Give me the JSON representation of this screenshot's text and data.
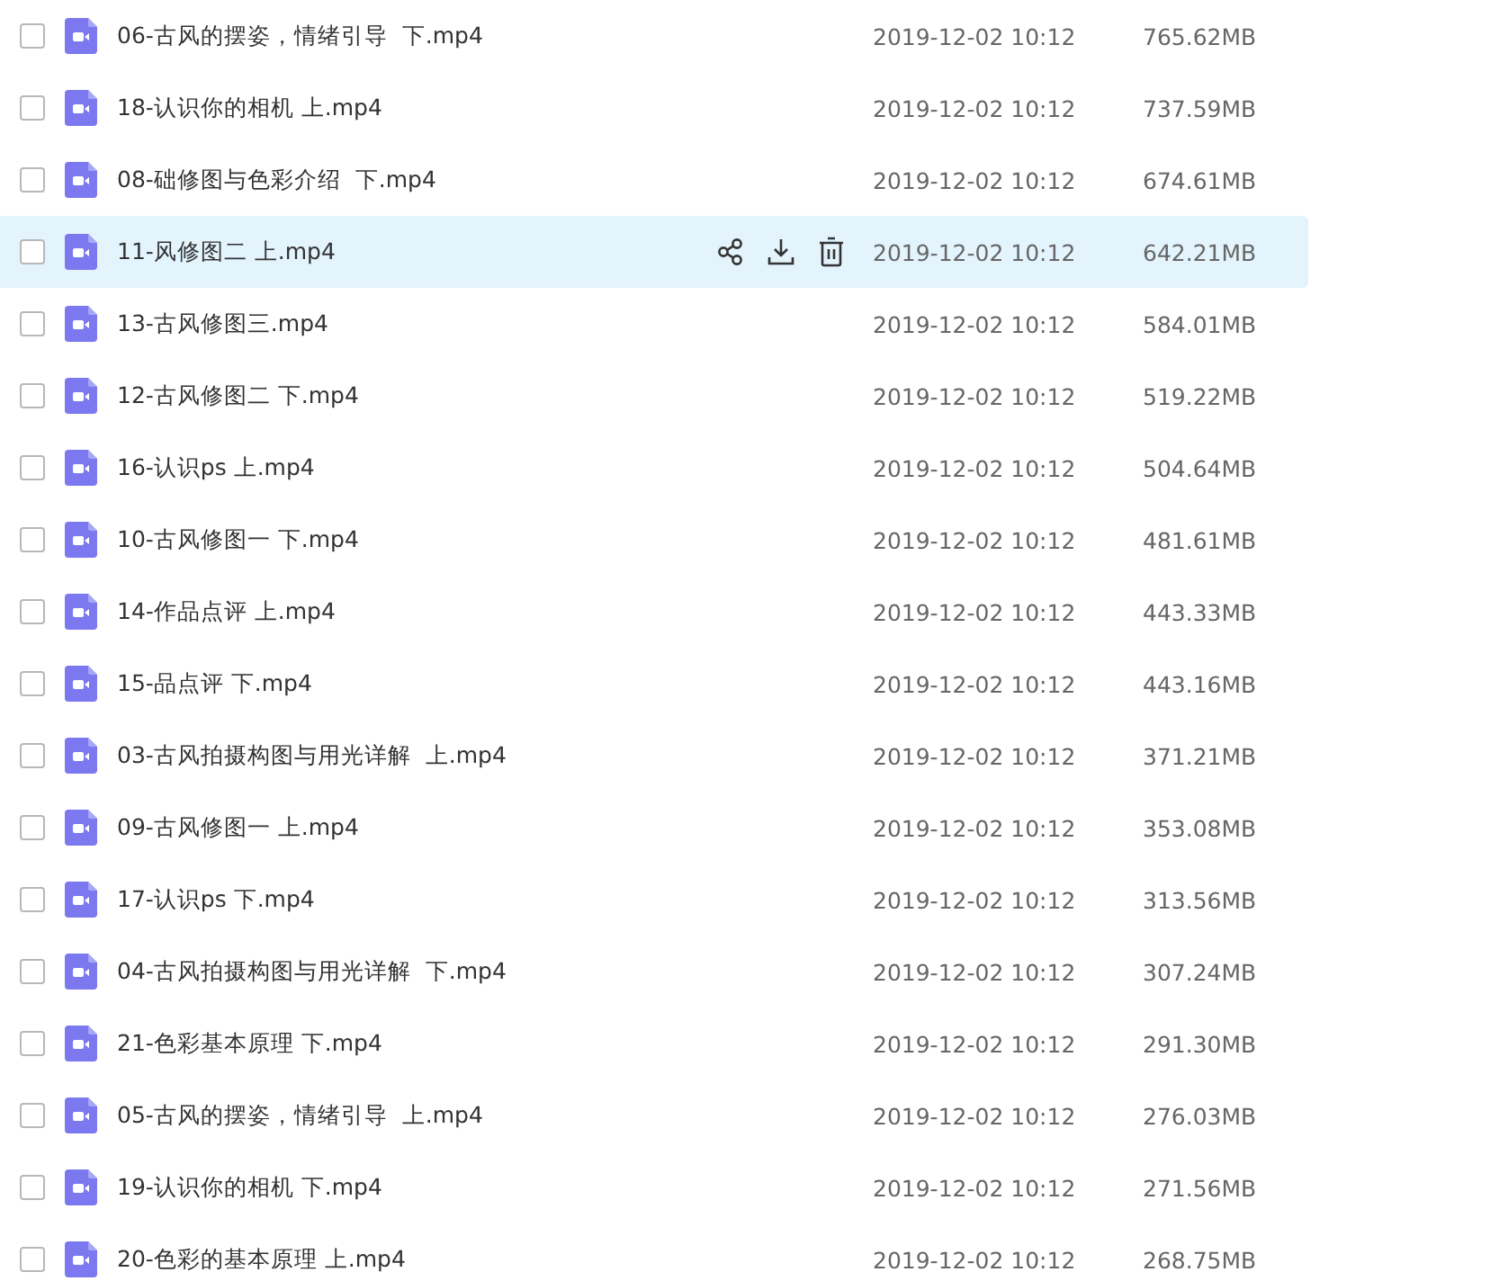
{
  "files": [
    {
      "name": "06-古风的摆姿，情绪引导  下.mp4",
      "date": "2019-12-02 10:12",
      "size": "765.62MB",
      "checked": false,
      "highlighted": false
    },
    {
      "name": "18-认识你的相机 上.mp4",
      "date": "2019-12-02 10:12",
      "size": "737.59MB",
      "checked": false,
      "highlighted": false
    },
    {
      "name": "08-础修图与色彩介绍  下.mp4",
      "date": "2019-12-02 10:12",
      "size": "674.61MB",
      "checked": false,
      "highlighted": false
    },
    {
      "name": "11-风修图二 上.mp4",
      "date": "2019-12-02 10:12",
      "size": "642.21MB",
      "checked": false,
      "highlighted": true
    },
    {
      "name": "13-古风修图三.mp4",
      "date": "2019-12-02 10:12",
      "size": "584.01MB",
      "checked": false,
      "highlighted": false
    },
    {
      "name": "12-古风修图二 下.mp4",
      "date": "2019-12-02 10:12",
      "size": "519.22MB",
      "checked": false,
      "highlighted": false
    },
    {
      "name": "16-认识ps 上.mp4",
      "date": "2019-12-02 10:12",
      "size": "504.64MB",
      "checked": false,
      "highlighted": false
    },
    {
      "name": "10-古风修图一 下.mp4",
      "date": "2019-12-02 10:12",
      "size": "481.61MB",
      "checked": false,
      "highlighted": false
    },
    {
      "name": "14-作品点评 上.mp4",
      "date": "2019-12-02 10:12",
      "size": "443.33MB",
      "checked": false,
      "highlighted": false
    },
    {
      "name": "15-品点评 下.mp4",
      "date": "2019-12-02 10:12",
      "size": "443.16MB",
      "checked": false,
      "highlighted": false
    },
    {
      "name": "03-古风拍摄构图与用光详解  上.mp4",
      "date": "2019-12-02 10:12",
      "size": "371.21MB",
      "checked": false,
      "highlighted": false
    },
    {
      "name": "09-古风修图一 上.mp4",
      "date": "2019-12-02 10:12",
      "size": "353.08MB",
      "checked": false,
      "highlighted": false
    },
    {
      "name": "17-认识ps 下.mp4",
      "date": "2019-12-02 10:12",
      "size": "313.56MB",
      "checked": false,
      "highlighted": false
    },
    {
      "name": "04-古风拍摄构图与用光详解  下.mp4",
      "date": "2019-12-02 10:12",
      "size": "307.24MB",
      "checked": false,
      "highlighted": false
    },
    {
      "name": "21-色彩基本原理 下.mp4",
      "date": "2019-12-02 10:12",
      "size": "291.30MB",
      "checked": false,
      "highlighted": false
    },
    {
      "name": "05-古风的摆姿，情绪引导  上.mp4",
      "date": "2019-12-02 10:12",
      "size": "276.03MB",
      "checked": false,
      "highlighted": false
    },
    {
      "name": "19-认识你的相机 下.mp4",
      "date": "2019-12-02 10:12",
      "size": "271.56MB",
      "checked": false,
      "highlighted": false
    },
    {
      "name": "20-色彩的基本原理 上.mp4",
      "date": "2019-12-02 10:12",
      "size": "268.75MB",
      "checked": false,
      "highlighted": false
    }
  ]
}
